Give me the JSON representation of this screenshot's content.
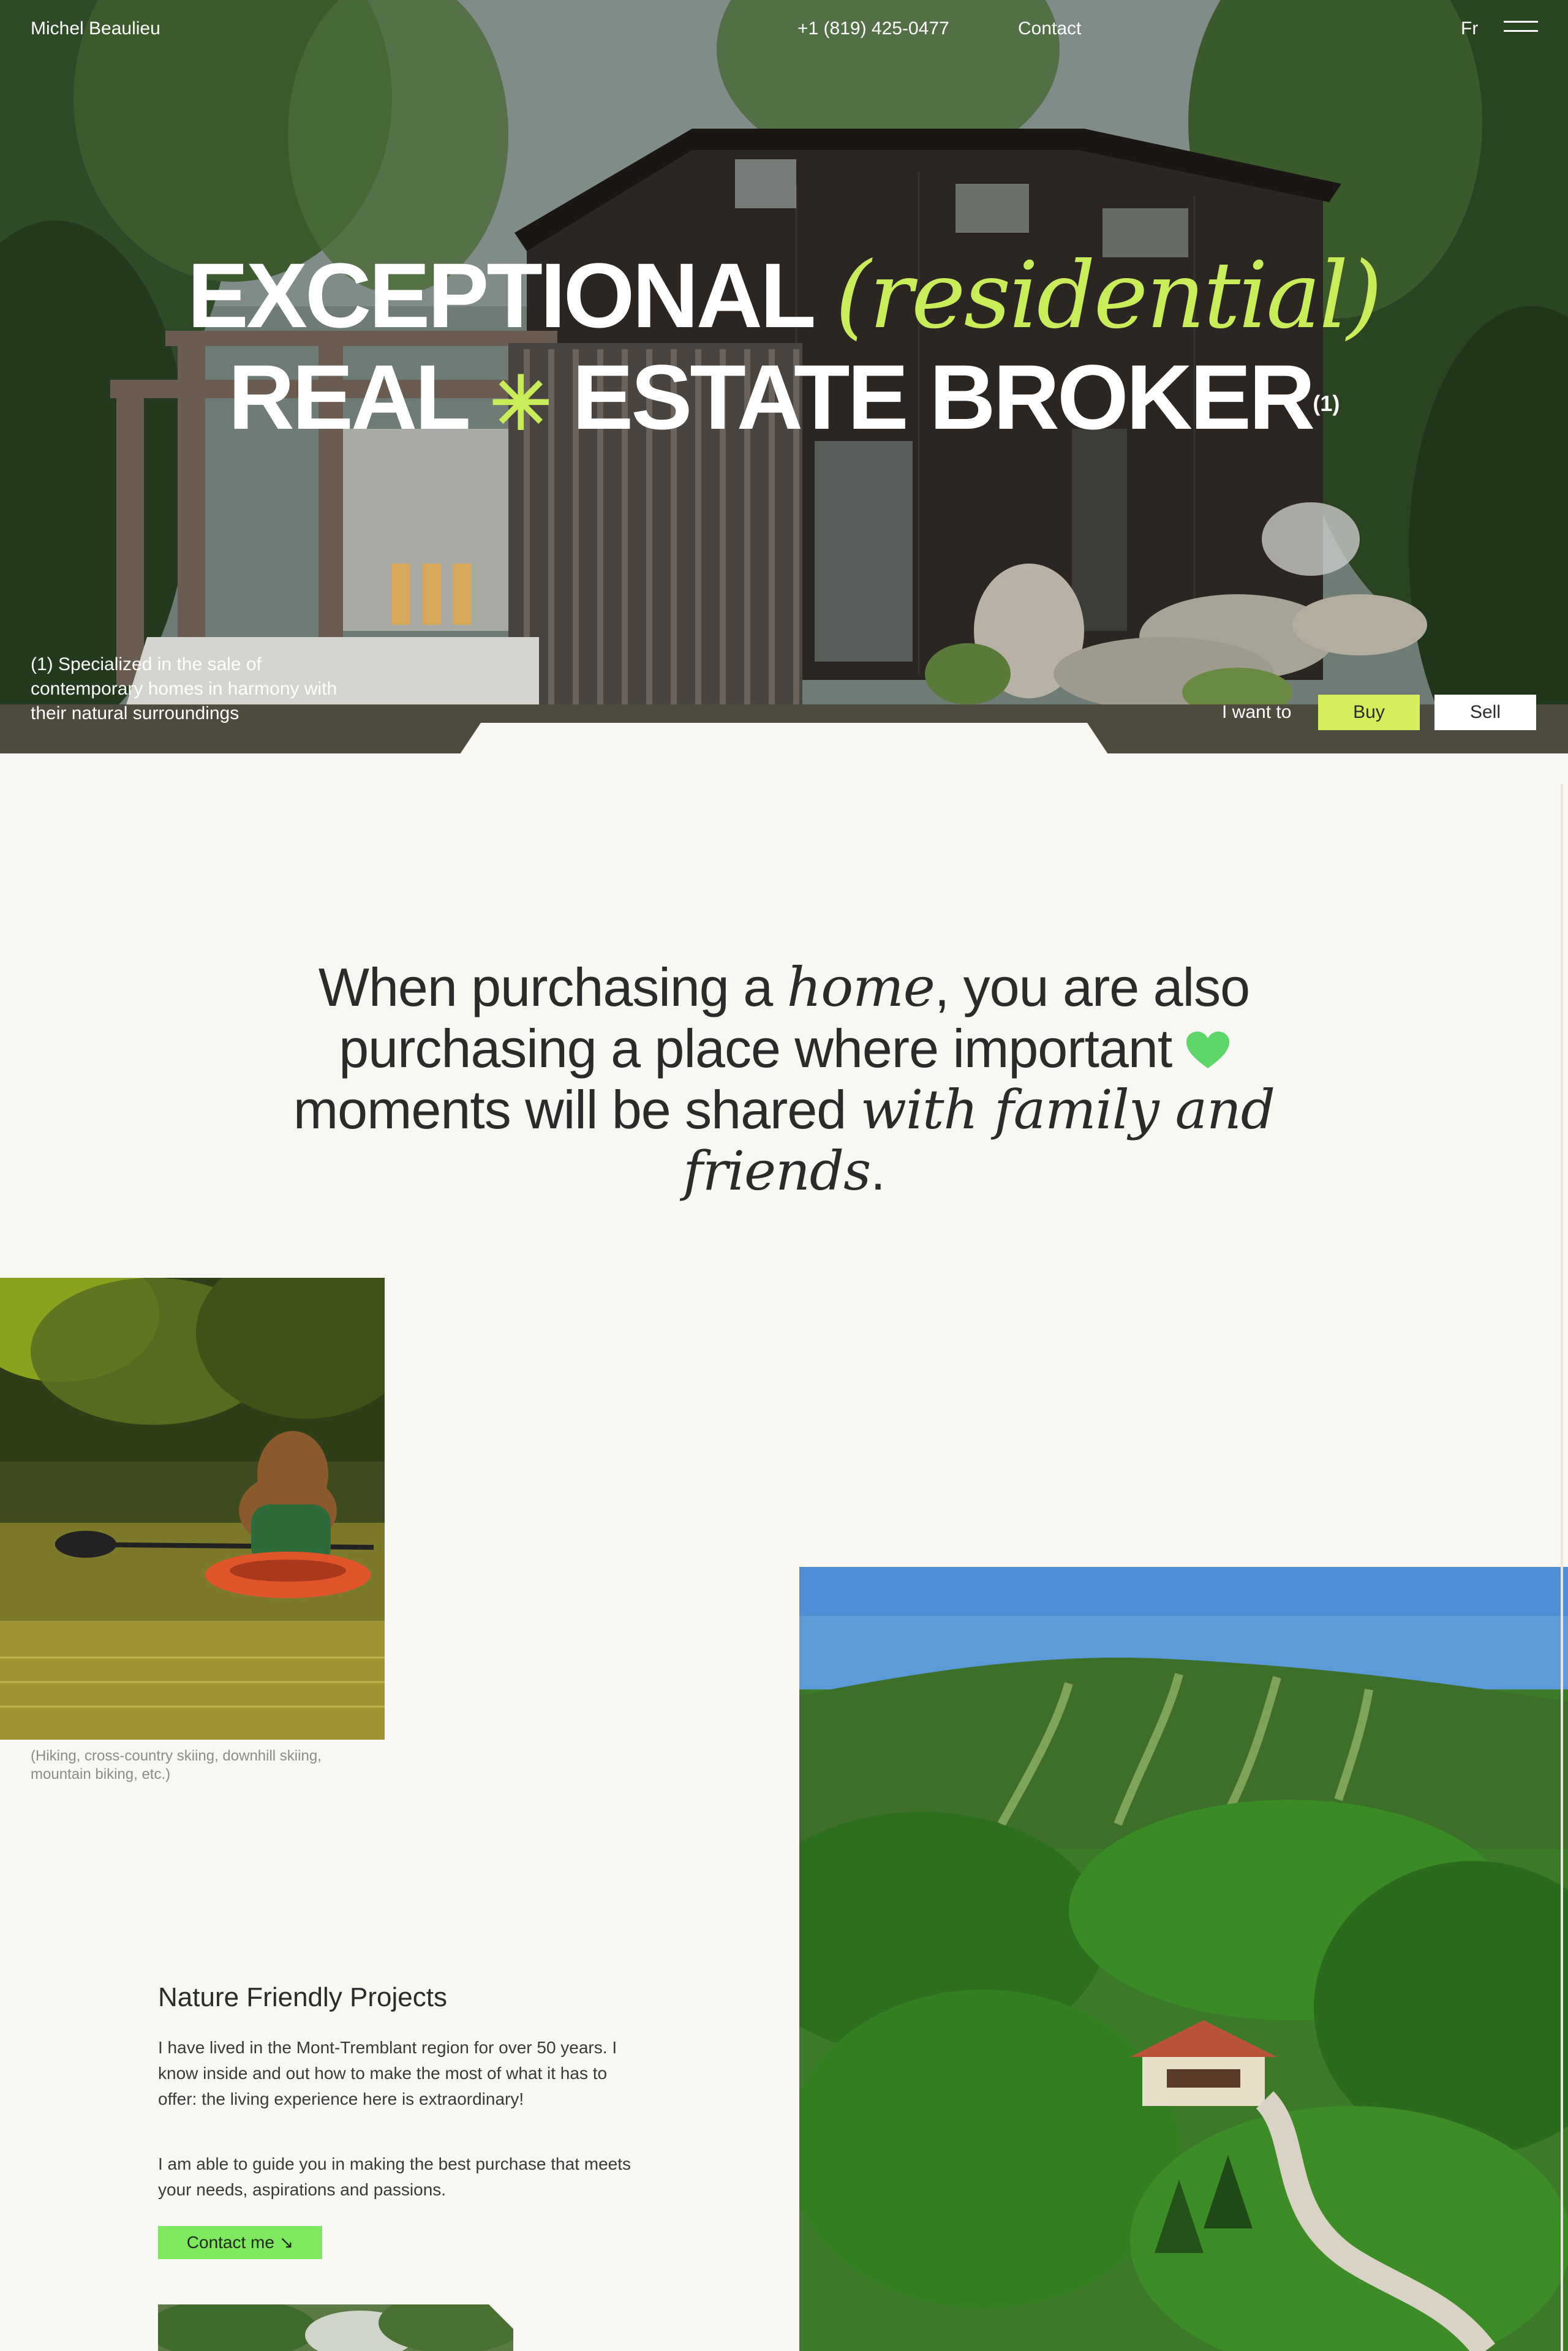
{
  "header": {
    "brand": "Michel Beaulieu",
    "phone": "+1 (819) 425-0477",
    "contact": "Contact",
    "lang": "Fr",
    "menu_icon": "hamburger-menu-icon"
  },
  "hero": {
    "line1_word": "EXCEPTIONAL",
    "line1_accent": "(residential)",
    "line2_a": "REAL",
    "line2_star": "✳",
    "line2_b": "ESTATE BROKER",
    "line2_sup": "(1)",
    "footnote": "(1) Specialized in the sale of contemporary homes in harmony with their natural surroundings",
    "want_label": "I want to",
    "buy": "Buy",
    "sell": "Sell"
  },
  "intro": {
    "t1": "When purchasing a ",
    "t1_serif": "home",
    "t2": ", you are also purchasing a place where important ",
    "t3": " moments will be shared ",
    "t3_serif": "with family and friends",
    "t4": ".",
    "heart_icon": "heart-icon",
    "heart_color": "#5fd66a"
  },
  "gallery": {
    "caption": "(Hiking, cross-country skiing, downhill skiing, mountain biking, etc.)"
  },
  "nature": {
    "title": "Nature Friendly Projects",
    "p1": "I have lived in the Mont-Tremblant region for over 50 years. I know inside and out how to make the most of what it has to offer: the living experience here is extraordinary!",
    "p2": "I am able to guide you in making the best purchase that meets your needs, aspirations and passions.",
    "cta": "Contact me ↘"
  },
  "colors": {
    "accent_lime": "#c9ec5a",
    "button_green": "#7ee85f",
    "background": "#f8f7f1"
  }
}
